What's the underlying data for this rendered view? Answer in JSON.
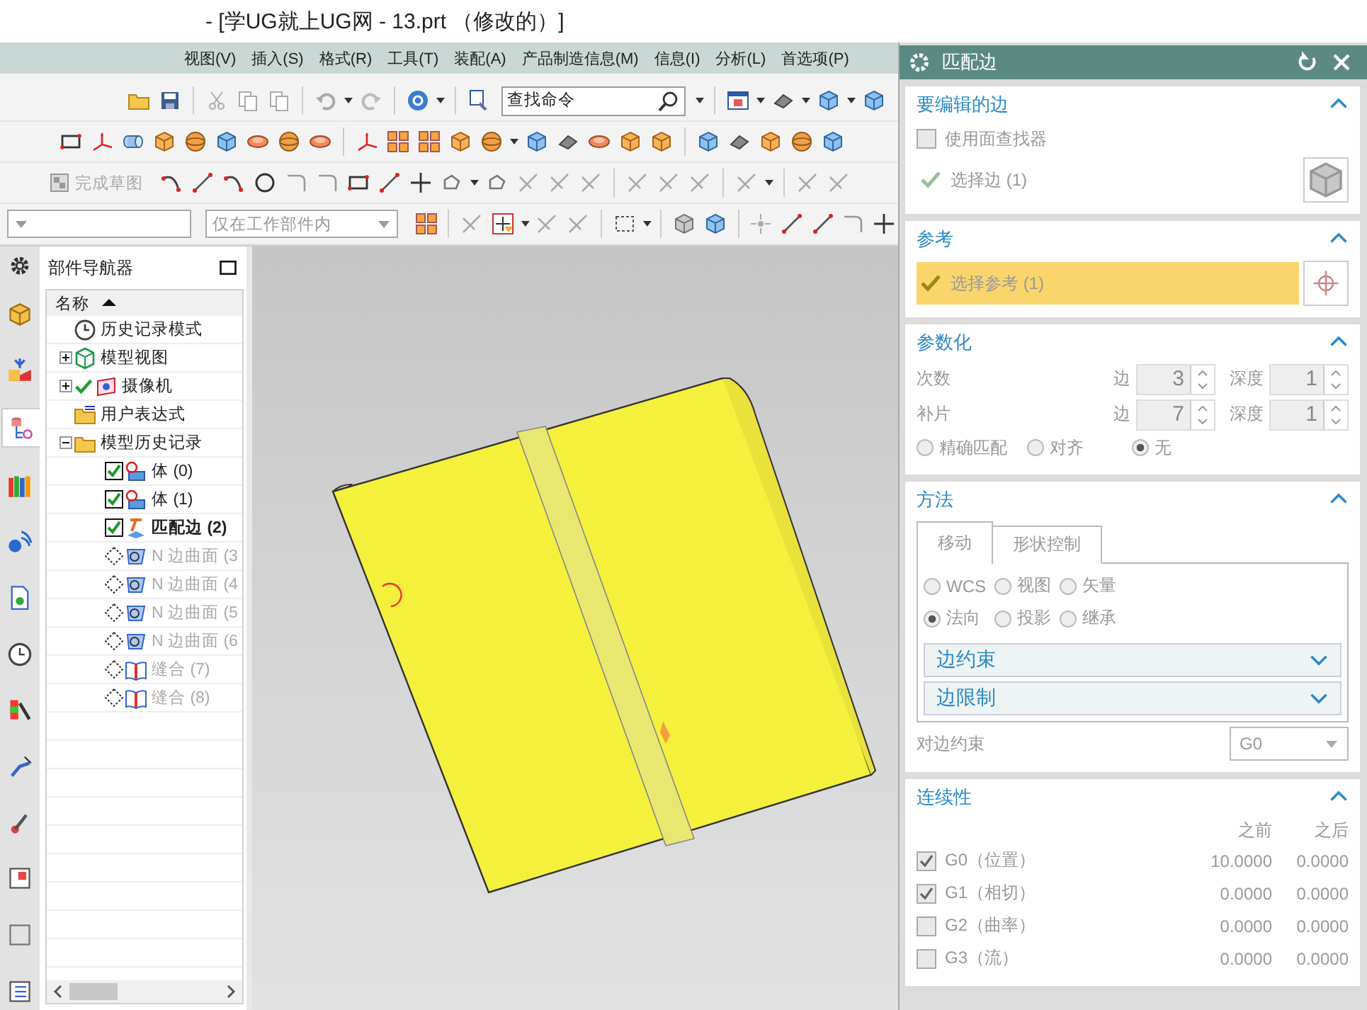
{
  "window": {
    "title": "- [学UG就上UG网 - 13.prt （修改的）]"
  },
  "menu": [
    "视图(V)",
    "插入(S)",
    "格式(R)",
    "工具(T)",
    "装配(A)",
    "产品制造信息(M)",
    "信息(I)",
    "分析(L)",
    "首选项(P)"
  ],
  "toolbar": {
    "search": {
      "placeholder": "查找命令"
    },
    "finish_sketch": {
      "label": "完成草图",
      "disabled": true
    },
    "scope": {
      "value": "仅在工作部件内"
    }
  },
  "resource_bar": {
    "tabs": [
      {
        "selected": false
      },
      {
        "selected": false
      },
      {
        "selected": true
      },
      {
        "selected": false
      },
      {
        "selected": false
      },
      {
        "selected": false
      },
      {
        "selected": false
      },
      {
        "selected": false
      },
      {
        "selected": false
      },
      {
        "selected": false
      },
      {
        "selected": false
      },
      {
        "selected": false
      },
      {
        "selected": false
      }
    ]
  },
  "navigator": {
    "title": "部件导航器",
    "column": "名称",
    "items": [
      {
        "label": "历史记录模式",
        "kind": "clock"
      },
      {
        "label": "模型视图",
        "kind": "views",
        "expanded": false
      },
      {
        "label": "摄像机",
        "kind": "camera",
        "expanded": false,
        "checked": true
      },
      {
        "label": "用户表达式",
        "kind": "expressions"
      },
      {
        "label": "模型历史记录",
        "kind": "folder",
        "expanded": true,
        "children": [
          {
            "label": "体 (0)",
            "kind": "body",
            "active": true,
            "current": false
          },
          {
            "label": "体 (1)",
            "kind": "body",
            "active": true,
            "current": false
          },
          {
            "label": "匹配边 (2)",
            "kind": "match",
            "active": true,
            "current": true
          },
          {
            "label": "N 边曲面 (3",
            "kind": "nsided",
            "active": false,
            "current": false
          },
          {
            "label": "N 边曲面 (4",
            "kind": "nsided",
            "active": false,
            "current": false
          },
          {
            "label": "N 边曲面 (5",
            "kind": "nsided",
            "active": false,
            "current": false
          },
          {
            "label": "N 边曲面 (6",
            "kind": "nsided",
            "active": false,
            "current": false
          },
          {
            "label": "缝合 (7)",
            "kind": "sew",
            "active": false,
            "current": false
          },
          {
            "label": "缝合 (8)",
            "kind": "sew",
            "active": false,
            "current": false
          }
        ]
      }
    ]
  },
  "dialog": {
    "title": "匹配边",
    "sections": [
      {
        "kind": "edges",
        "title": "要编辑的边",
        "expanded": true,
        "finder": {
          "label": "使用面查找器",
          "checked": false
        },
        "select": {
          "label": "选择边 (1)",
          "selected": false
        }
      },
      {
        "kind": "reference",
        "title": "参考",
        "expanded": true,
        "select": {
          "label": "选择参考 (1)",
          "selected": true
        }
      },
      {
        "kind": "parameters",
        "title": "参数化",
        "expanded": true,
        "rows": [
          {
            "label": "次数",
            "edge_label": "边",
            "edge": "3",
            "depth_label": "深度",
            "depth": "1"
          },
          {
            "label": "补片",
            "edge_label": "边",
            "edge": "7",
            "depth_label": "深度",
            "depth": "1"
          }
        ],
        "options": [
          {
            "label": "精确匹配",
            "selected": false
          },
          {
            "label": "对齐",
            "selected": false
          },
          {
            "label": "无",
            "selected": true
          }
        ]
      },
      {
        "kind": "method",
        "title": "方法",
        "expanded": true,
        "tabs": [
          {
            "label": "移动",
            "selected": true
          },
          {
            "label": "形状控制",
            "selected": false
          }
        ],
        "options": [
          {
            "label": "WCS",
            "selected": false
          },
          {
            "label": "视图",
            "selected": false
          },
          {
            "label": "矢量",
            "selected": false
          },
          {
            "label": "法向",
            "selected": true
          },
          {
            "label": "投影",
            "selected": false
          },
          {
            "label": "继承",
            "selected": false
          }
        ],
        "groups": [
          {
            "title": "边约束",
            "expanded": false
          },
          {
            "title": "边限制",
            "expanded": false
          }
        ],
        "opposite": {
          "label": "对边约束",
          "value": "G0"
        }
      },
      {
        "kind": "continuity",
        "title": "连续性",
        "expanded": true,
        "columns": [
          "之前",
          "之后"
        ],
        "rows": [
          {
            "label": "G0（位置）",
            "checked": true,
            "before": "10.0000",
            "after": "0.0000"
          },
          {
            "label": "G1（相切）",
            "checked": true,
            "before": "0.0000",
            "after": "0.0000"
          },
          {
            "label": "G2（曲率）",
            "checked": false,
            "before": "0.0000",
            "after": "0.0000"
          },
          {
            "label": "G3（流）",
            "checked": false,
            "before": "0.0000",
            "after": "0.0000"
          }
        ]
      }
    ]
  }
}
